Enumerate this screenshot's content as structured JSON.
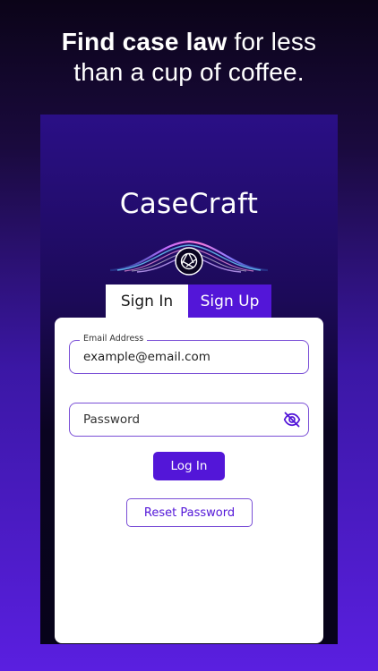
{
  "headline": {
    "bold": "Find case law",
    "rest_line1": " for less",
    "line2": "than a cup of coffee."
  },
  "app": {
    "brand_name": "CaseCraft",
    "logo_icon": "camera-aperture-icon"
  },
  "tabs": [
    {
      "label": "Sign In",
      "active": true
    },
    {
      "label": "Sign Up",
      "active": false
    }
  ],
  "form": {
    "email": {
      "label": "Email Address",
      "value": "example@email.com"
    },
    "password": {
      "placeholder": "Password",
      "visibility_icon": "eye-off-icon"
    },
    "login_label": "Log In",
    "reset_label": "Reset Password"
  },
  "colors": {
    "accent": "#5316d8",
    "field_border": "#7a4fd6"
  }
}
